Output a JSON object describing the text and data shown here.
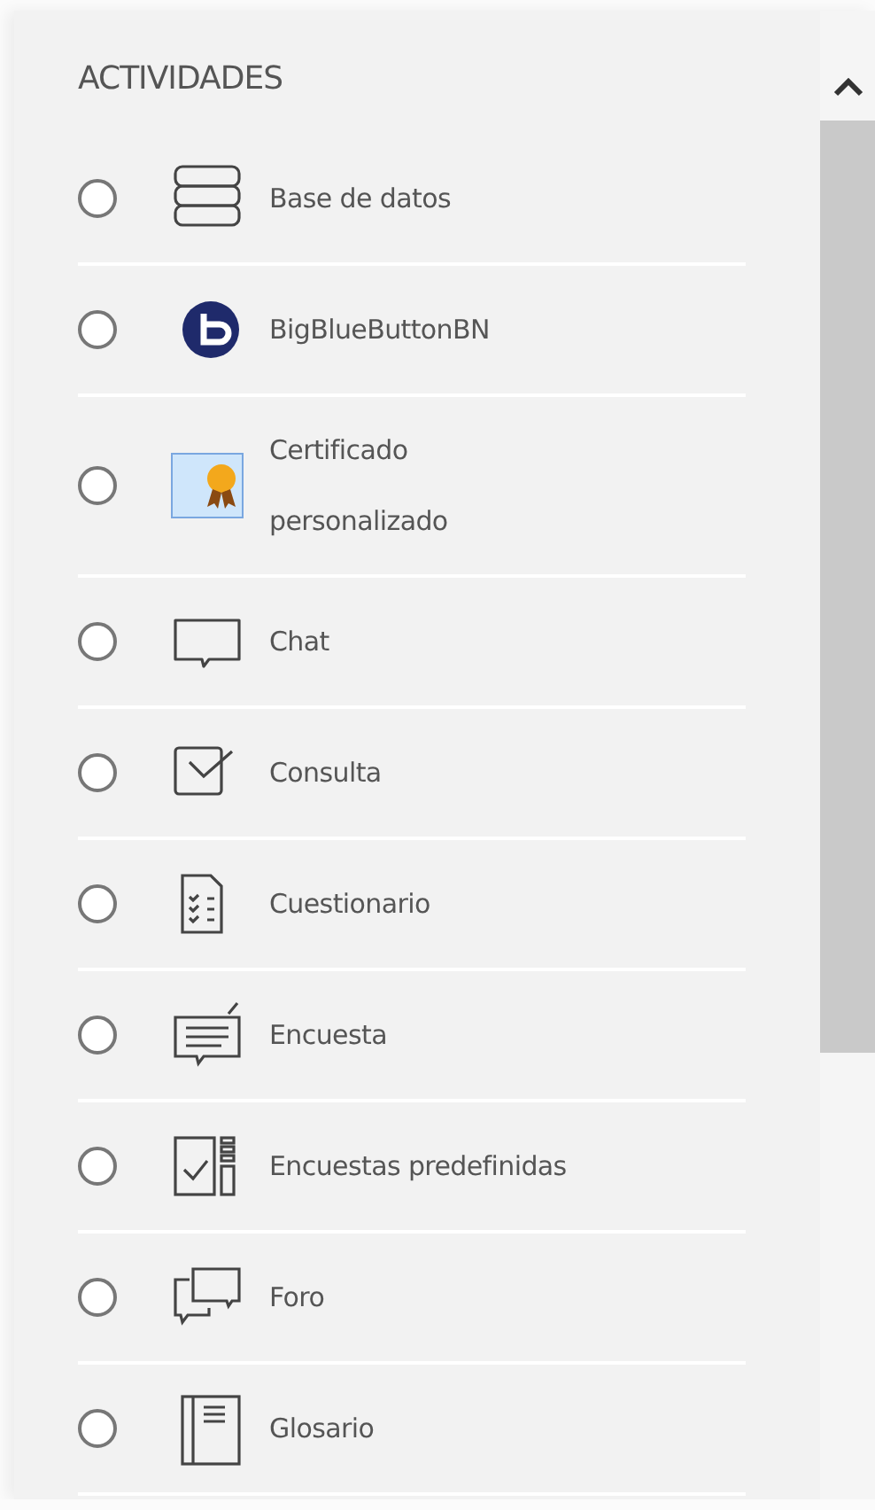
{
  "panel": {
    "title": "ACTIVIDADES",
    "items": [
      {
        "label": "Base de datos",
        "kind": "database",
        "selected": false
      },
      {
        "label": "BigBlueButtonBN",
        "kind": "bbb",
        "selected": false
      },
      {
        "label": "Certificado personalizado",
        "kind": "certificate",
        "selected": false
      },
      {
        "label": "Chat",
        "kind": "chat",
        "selected": false
      },
      {
        "label": "Consulta",
        "kind": "choice",
        "selected": false
      },
      {
        "label": "Cuestionario",
        "kind": "quiz",
        "selected": false
      },
      {
        "label": "Encuesta",
        "kind": "feedback",
        "selected": false
      },
      {
        "label": "Encuestas predefinidas",
        "kind": "survey",
        "selected": false
      },
      {
        "label": "Foro",
        "kind": "forum",
        "selected": false
      },
      {
        "label": "Glosario",
        "kind": "glossary",
        "selected": false
      }
    ]
  }
}
